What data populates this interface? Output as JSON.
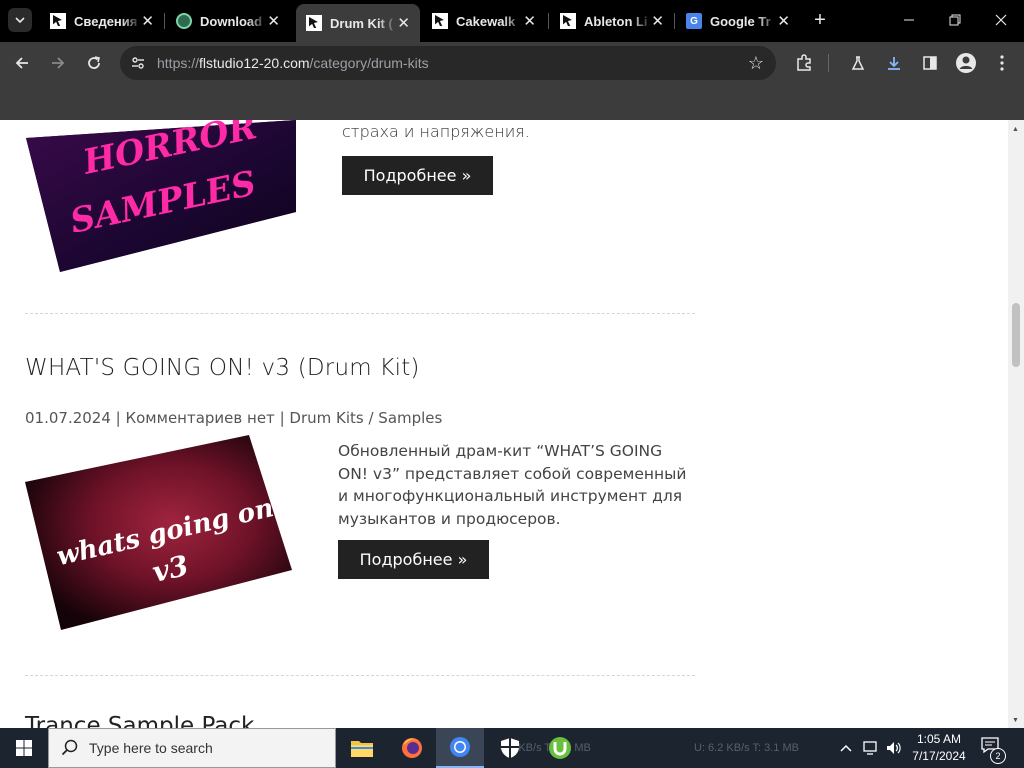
{
  "browser": {
    "tabs": [
      {
        "title": "Сведения",
        "favicon": "fl-studio-icon",
        "active": false
      },
      {
        "title": "Download",
        "favicon": "download-site-icon",
        "active": false
      },
      {
        "title": "Drum Kit (",
        "favicon": "fl-studio-icon",
        "active": true
      },
      {
        "title": "Cakewalk",
        "favicon": "fl-studio-icon",
        "active": false
      },
      {
        "title": "Ableton Li",
        "favicon": "fl-studio-icon",
        "active": false
      },
      {
        "title": "Google Tr",
        "favicon": "google-translate-icon",
        "active": false
      }
    ],
    "new_tab_label": "+",
    "url_scheme": "https://",
    "url_host": "flstudio12-20.com",
    "url_path": "/category/drum-kits"
  },
  "page": {
    "prev_excerpt_tail": "страха и напряжения.",
    "prev_more": "Подробнее »",
    "post": {
      "title": "WHAT'S GOING ON! v3 (Drum Kit)",
      "date": "01.07.2024",
      "sep1": " | ",
      "comments": "Комментариев нет",
      "sep2": " | ",
      "category1": "Drum Kits",
      "cat_sep": " / ",
      "category2": "Samples",
      "excerpt": "Обновленный драм-кит “WHAT’S GOING ON! v3” представляет собой современный и многофункциональный инструмент для музыкантов и продюсеров.",
      "more": "Подробнее »",
      "image_text_line1": "whats going on!",
      "image_text_line2": "v3"
    },
    "prev_image_text_line1": "HORROR",
    "prev_image_text_line2": "SAMPLES",
    "next_title_partial": "Trance Sample Pack"
  },
  "taskbar": {
    "search_placeholder": "Type here to search",
    "time": "1:05 AM",
    "date": "7/17/2024",
    "notifications": "2",
    "ghost_left": "4.2 KB/s  T: 1.1 MB",
    "ghost_right": "U: 6.2 KB/s  T: 3.1 MB"
  },
  "colors": {
    "tab_strip": "#000000",
    "toolbar": "#3c3c3c",
    "button_bg": "#222222",
    "taskbar": "#1c2430"
  }
}
